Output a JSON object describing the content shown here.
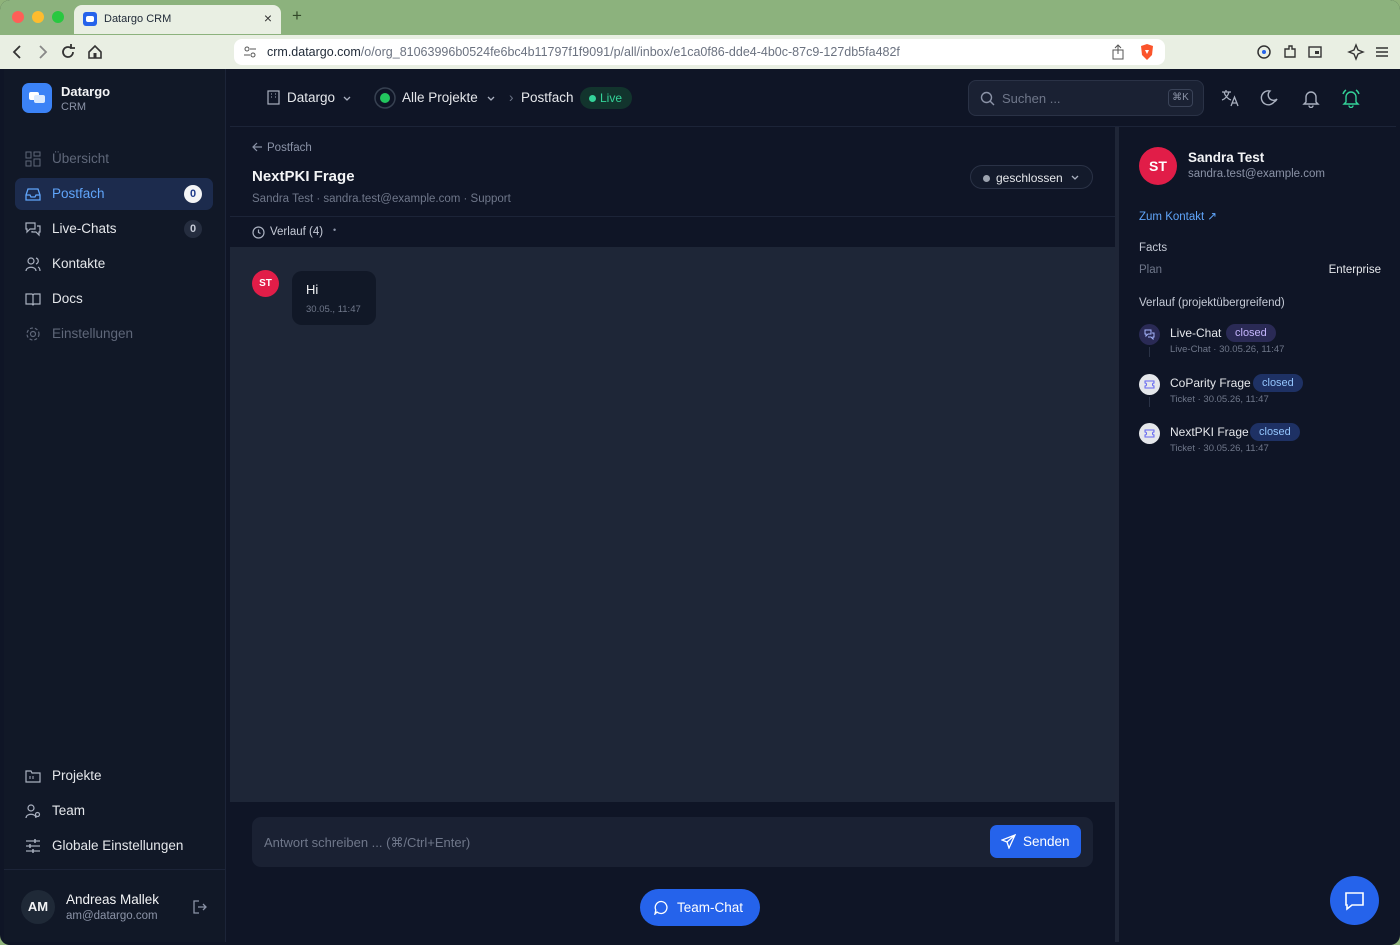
{
  "browser": {
    "tab_title": "Datargo CRM",
    "tab_close": "×",
    "tab_new": "+",
    "url_host": "crm.datargo.com",
    "url_path": "/o/org_81063996b0524fe6bc4b11797f1f9091/p/all/inbox/e1ca0f86-dde4-4b0c-87c9-127db5fa482f"
  },
  "sidebar": {
    "brand": {
      "name": "Datargo",
      "sub": "CRM"
    },
    "items": [
      {
        "label": "Übersicht",
        "icon": "dashboard-icon",
        "state": "disabled"
      },
      {
        "label": "Postfach",
        "icon": "inbox-icon",
        "state": "active",
        "badge": "0"
      },
      {
        "label": "Live-Chats",
        "icon": "chat-icon",
        "state": "normal",
        "badge": "0"
      },
      {
        "label": "Kontakte",
        "icon": "contacts-icon",
        "state": "normal"
      },
      {
        "label": "Docs",
        "icon": "book-icon",
        "state": "normal"
      },
      {
        "label": "Einstellungen",
        "icon": "gear-icon",
        "state": "disabled"
      }
    ],
    "bottom_items": [
      {
        "label": "Projekte",
        "icon": "folder-icon"
      },
      {
        "label": "Team",
        "icon": "team-icon"
      },
      {
        "label": "Globale Einstellungen",
        "icon": "sliders-icon"
      }
    ],
    "user": {
      "initials": "AM",
      "name": "Andreas Mallek",
      "email": "am@datargo.com"
    }
  },
  "topbar": {
    "org": "Datargo",
    "project": "Alle Projekte",
    "separator": "›",
    "page": "Postfach",
    "live_label": "Live",
    "search_placeholder": "Suchen ...",
    "search_shortcut": "⌘K"
  },
  "conversation": {
    "back_label": "Postfach",
    "title": "NextPKI Frage",
    "meta": "Sandra Test · sandra.test@example.com · Support",
    "status": "geschlossen",
    "history_label": "Verlauf (4)",
    "history_dot": "•",
    "messages": [
      {
        "avatar": "ST",
        "text": "Hi",
        "time": "30.05., 11:47"
      }
    ],
    "composer_placeholder": "Antwort schreiben ... (⌘/Ctrl+Enter)",
    "send_label": "Senden",
    "team_chat_label": "Team-Chat"
  },
  "contact": {
    "initials": "ST",
    "name": "Sandra Test",
    "email": "sandra.test@example.com",
    "link_label": "Zum Kontakt",
    "link_arrow": "↗",
    "facts_heading": "Facts",
    "plan_label": "Plan",
    "plan_value": "Enterprise",
    "history_heading": "Verlauf (projektübergreifend)",
    "history": [
      {
        "title": "Live-Chat",
        "status": "closed",
        "sub": "Live-Chat · 30.05.26, 11:47",
        "kind": "chat"
      },
      {
        "title": "CoParity Frage",
        "status": "closed",
        "sub": "Ticket · 30.05.26, 11:47",
        "kind": "ticket"
      },
      {
        "title": "NextPKI Frage",
        "status": "closed",
        "sub": "Ticket · 30.05.26, 11:47",
        "kind": "ticket"
      }
    ]
  },
  "colors": {
    "accent": "#2563eb",
    "live": "#34d399",
    "avatar_contact": "#e11d48",
    "background": "#0f1526"
  }
}
